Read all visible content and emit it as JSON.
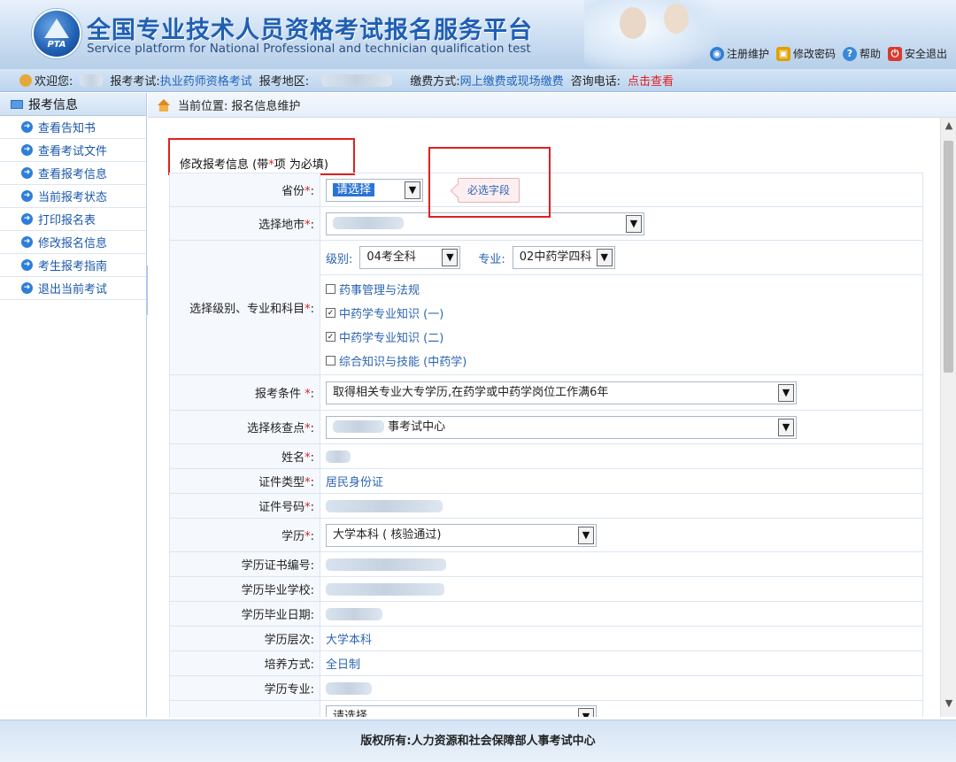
{
  "header": {
    "logo_text": "PTA",
    "title_cn": "全国专业技术人员资格考试报名服务平台",
    "title_en": "Service platform for National Professional and technician qualification test",
    "links": [
      {
        "label": "注册维护",
        "icon": "globe-icon"
      },
      {
        "label": "修改密码",
        "icon": "lock-icon"
      },
      {
        "label": "帮助",
        "icon": "help-icon"
      },
      {
        "label": "安全退出",
        "icon": "power-icon"
      }
    ]
  },
  "infobar": {
    "welcome": "欢迎您:",
    "exam_label": "报考考试:",
    "exam_value": "执业药师资格考试",
    "region_label": "报考地区:",
    "payment_label": "缴费方式:",
    "payment_value": "网上缴费或现场缴费",
    "phone_label": "咨询电话:",
    "phone_link": "点击查看"
  },
  "sidebar": {
    "header": "报考信息",
    "items": [
      {
        "label": "查看告知书"
      },
      {
        "label": "查看考试文件"
      },
      {
        "label": "查看报考信息"
      },
      {
        "label": "当前报考状态"
      },
      {
        "label": "打印报名表"
      },
      {
        "label": "修改报名信息"
      },
      {
        "label": "考生报考指南"
      },
      {
        "label": "退出当前考试"
      }
    ]
  },
  "breadcrumb": {
    "label": "当前位置:",
    "value": "报名信息维护"
  },
  "form": {
    "title": "修改报考信息 (带",
    "title_star": "*",
    "title_suffix": "项 为必填)",
    "tooltip": "必选字段",
    "province": {
      "label": "省份",
      "value": "请选择"
    },
    "city": {
      "label": "选择地市"
    },
    "level_major": {
      "label": "选择级别、专业和科目",
      "level_label": "级别:",
      "level_value": "04考全科",
      "major_label": "专业:",
      "major_value": "02中药学四科",
      "subjects": [
        {
          "name": "药事管理与法规",
          "checked": false
        },
        {
          "name": "中药学专业知识 (一)",
          "checked": true
        },
        {
          "name": "中药学专业知识 (二)",
          "checked": true
        },
        {
          "name": "综合知识与技能 (中药学)",
          "checked": false
        }
      ]
    },
    "condition": {
      "label": "报考条件 ",
      "value": "取得相关专业大专学历,在药学或中药学岗位工作满6年"
    },
    "checkpoint": {
      "label": "选择核查点",
      "value_suffix": "事考试中心"
    },
    "name": {
      "label": "姓名"
    },
    "id_type": {
      "label": "证件类型",
      "value": "居民身份证"
    },
    "id_number": {
      "label": "证件号码"
    },
    "education": {
      "label": "学历",
      "value": "大学本科 ( 核验通过)"
    },
    "edu_cert_no": {
      "label": "学历证书编号:"
    },
    "edu_school": {
      "label": "学历毕业学校:"
    },
    "edu_date": {
      "label": "学历毕业日期:"
    },
    "edu_level": {
      "label": "学历层次:",
      "value": "大学本科"
    },
    "training_mode": {
      "label": "培养方式:",
      "value": "全日制"
    },
    "edu_major": {
      "label": "学历专业:"
    },
    "next_select": {
      "value": "请选择"
    }
  },
  "footer": {
    "copyright": "版权所有:人力资源和社会保障部人事考试中心"
  },
  "colors": {
    "brand_blue": "#1f5fb3",
    "required_red": "#e02020",
    "link_blue": "#2266bb"
  }
}
